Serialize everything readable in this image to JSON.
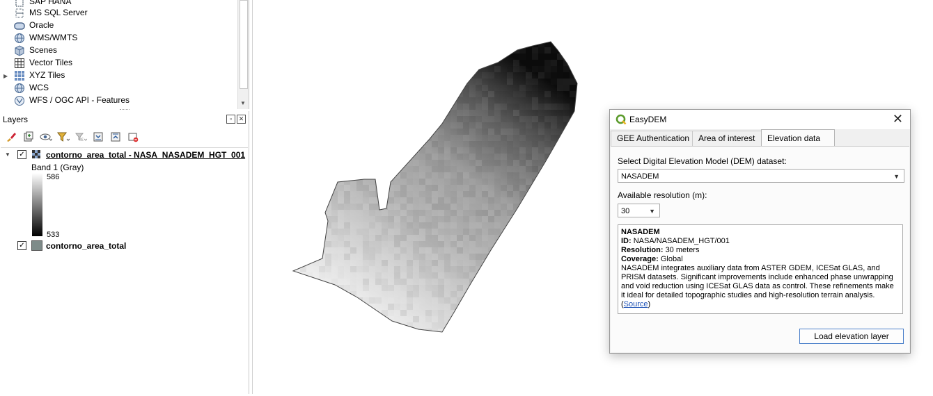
{
  "browser": {
    "items": [
      {
        "label": "SAP HANA",
        "icon": "sap-hana-icon"
      },
      {
        "label": "MS SQL Server",
        "icon": "mssql-icon"
      },
      {
        "label": "Oracle",
        "icon": "oracle-icon"
      },
      {
        "label": "WMS/WMTS",
        "icon": "globe-icon"
      },
      {
        "label": "Scenes",
        "icon": "cube-icon"
      },
      {
        "label": "Vector Tiles",
        "icon": "grid-icon"
      },
      {
        "label": "XYZ Tiles",
        "icon": "tiles-icon"
      },
      {
        "label": "WCS",
        "icon": "globe-icon"
      },
      {
        "label": "WFS / OGC API - Features",
        "icon": "wfs-icon"
      }
    ]
  },
  "layers": {
    "title": "Layers",
    "raster_layer": "contorno_area_total - NASA_NASADEM_HGT_001",
    "band_label": "Band 1 (Gray)",
    "legend_max": "586",
    "legend_min": "533",
    "vector_layer": "contorno_area_total"
  },
  "dialog": {
    "title": "EasyDEM",
    "tabs": [
      "GEE Authentication",
      "Area of interest",
      "Elevation data"
    ],
    "active_tab": "Elevation data",
    "dataset_label": "Select Digital Elevation Model (DEM) dataset:",
    "dataset_value": "NASADEM",
    "resolution_label": "Available resolution (m):",
    "resolution_value": "30",
    "info": {
      "name": "NASADEM",
      "id_label": "ID:",
      "id_value": "NASA/NASADEM_HGT/001",
      "resolution_label": "Resolution:",
      "resolution_value": "30 meters",
      "coverage_label": "Coverage:",
      "coverage_value": "Global",
      "description": "NASADEM integrates auxiliary data from ASTER GDEM, ICESat GLAS, and PRISM datasets. Significant improvements include enhanced phase unwrapping and void reduction using ICESat GLAS data as control. These refinements make it ideal for detailed topographic studies and high-resolution terrain analysis.",
      "source_link": "Source"
    },
    "load_button": "Load elevation layer"
  }
}
